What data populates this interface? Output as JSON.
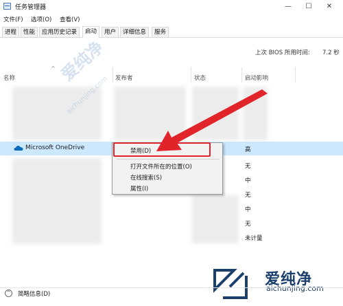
{
  "window": {
    "title": "任务管理器",
    "min": "—",
    "max": "☐",
    "close": "✕"
  },
  "menu": [
    "文件(F)",
    "选项(O)",
    "查看(V)"
  ],
  "tabs": [
    "进程",
    "性能",
    "应用历史记录",
    "启动",
    "用户",
    "详细信息",
    "服务"
  ],
  "active_tab": "启动",
  "bios": {
    "label": "上次 BIOS 所用时间:",
    "value": "7.2 秒"
  },
  "columns": [
    "名称",
    "发布者",
    "状态",
    "启动影响"
  ],
  "selected_item": {
    "name": "Microsoft OneDrive",
    "impact": "高"
  },
  "impacts_below": [
    "无",
    "中",
    "无",
    "中",
    "无",
    "未计量"
  ],
  "context_menu": [
    "禁用(D)",
    "打开文件所在的位置(O)",
    "在线搜索(S)",
    "属性(I)"
  ],
  "watermark": {
    "text": "爱纯净",
    "url": "aichunjing.com"
  },
  "footer": {
    "fewer_details": "简略信息(D)"
  },
  "colors": {
    "selection": "#cce8ff",
    "highlight": "#e0242a",
    "onedrive": "#0f6cbd"
  }
}
